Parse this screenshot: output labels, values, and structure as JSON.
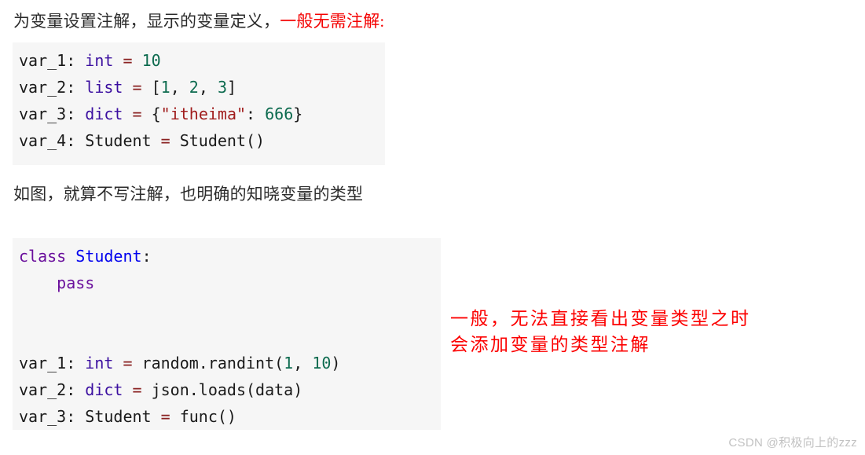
{
  "page": {
    "background_color": "#ffffff",
    "watermark": "CSDN @积极向上的zzz"
  },
  "intro": {
    "normal_text": "为变量设置注解，显示的变量定义，",
    "accent_text": "一般无需注解:",
    "accent_color": "#f40000"
  },
  "code_block_1": {
    "background_color": "#f6f6f6",
    "lines": [
      {
        "tokens": [
          {
            "text": "var_1: ",
            "type": "plain"
          },
          {
            "text": "int",
            "type": "type"
          },
          {
            "text": " ",
            "type": "plain"
          },
          {
            "text": "=",
            "type": "op"
          },
          {
            "text": " ",
            "type": "plain"
          },
          {
            "text": "10",
            "type": "num"
          }
        ]
      },
      {
        "tokens": [
          {
            "text": "var_2: ",
            "type": "plain"
          },
          {
            "text": "list",
            "type": "type"
          },
          {
            "text": " ",
            "type": "plain"
          },
          {
            "text": "=",
            "type": "op"
          },
          {
            "text": " [",
            "type": "plain"
          },
          {
            "text": "1",
            "type": "num"
          },
          {
            "text": ", ",
            "type": "plain"
          },
          {
            "text": "2",
            "type": "num"
          },
          {
            "text": ", ",
            "type": "plain"
          },
          {
            "text": "3",
            "type": "num"
          },
          {
            "text": "]",
            "type": "plain"
          }
        ]
      },
      {
        "tokens": [
          {
            "text": "var_3: ",
            "type": "plain"
          },
          {
            "text": "dict",
            "type": "type"
          },
          {
            "text": " ",
            "type": "plain"
          },
          {
            "text": "=",
            "type": "op"
          },
          {
            "text": " {",
            "type": "plain"
          },
          {
            "text": "\"itheima\"",
            "type": "str"
          },
          {
            "text": ": ",
            "type": "plain"
          },
          {
            "text": "666",
            "type": "num"
          },
          {
            "text": "}",
            "type": "plain"
          }
        ]
      },
      {
        "tokens": [
          {
            "text": "var_4: Student ",
            "type": "plain"
          },
          {
            "text": "=",
            "type": "op"
          },
          {
            "text": " Student()",
            "type": "plain"
          }
        ]
      }
    ]
  },
  "mid_text": "如图，就算不写注解，也明确的知晓变量的类型",
  "code_block_2": {
    "background_color": "#f6f6f6",
    "lines": [
      {
        "tokens": [
          {
            "text": "class",
            "type": "kw"
          },
          {
            "text": " ",
            "type": "plain"
          },
          {
            "text": "Student",
            "type": "cls"
          },
          {
            "text": ":",
            "type": "plain"
          }
        ]
      },
      {
        "tokens": [
          {
            "text": "    ",
            "type": "plain"
          },
          {
            "text": "pass",
            "type": "kw"
          }
        ]
      },
      {
        "tokens": []
      },
      {
        "tokens": []
      },
      {
        "tokens": [
          {
            "text": "var_1: ",
            "type": "plain"
          },
          {
            "text": "int",
            "type": "type"
          },
          {
            "text": " ",
            "type": "plain"
          },
          {
            "text": "=",
            "type": "op"
          },
          {
            "text": " random.randint(",
            "type": "plain"
          },
          {
            "text": "1",
            "type": "num"
          },
          {
            "text": ", ",
            "type": "plain"
          },
          {
            "text": "10",
            "type": "num"
          },
          {
            "text": ")",
            "type": "plain"
          }
        ]
      },
      {
        "tokens": [
          {
            "text": "var_2: ",
            "type": "plain"
          },
          {
            "text": "dict",
            "type": "type"
          },
          {
            "text": " ",
            "type": "plain"
          },
          {
            "text": "=",
            "type": "op"
          },
          {
            "text": " json.loads(data)",
            "type": "plain"
          }
        ]
      },
      {
        "tokens": [
          {
            "text": "var_3: Student ",
            "type": "plain"
          },
          {
            "text": "=",
            "type": "op"
          },
          {
            "text": " func()",
            "type": "plain"
          }
        ]
      }
    ]
  },
  "annotation": {
    "color": "#fc0000",
    "lines": [
      "一般，无法直接看出变量类型之时",
      "会添加变量的类型注解"
    ]
  },
  "token_colors": {
    "keyword": "#6a0f9c",
    "type": "#3b0fa0",
    "class_name": "#0000ee",
    "operator": "#8a2222",
    "number": "#0d6b4f",
    "string": "#a01c1c",
    "plain": "#1a1a1a"
  }
}
